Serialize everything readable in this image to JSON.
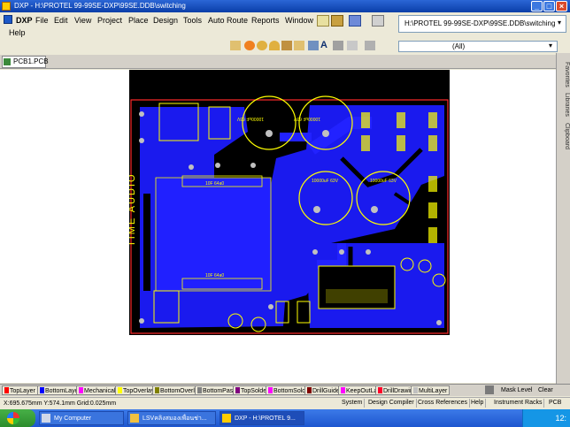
{
  "window": {
    "title": "DXP - H:\\PROTEL 99-99SE-DXP\\99SE.DDB\\switching",
    "buttons": [
      "_",
      "□",
      "×"
    ]
  },
  "menu": {
    "items": [
      "DXP",
      "File",
      "Edit",
      "View",
      "Project",
      "Place",
      "Design",
      "Tools",
      "Auto Route",
      "Reports",
      "Window",
      "Help"
    ]
  },
  "path_box": "H:\\PROTEL 99-99SE-DXP\\99SE.DDB\\switching",
  "filter_box": "(All)",
  "document_tab": "PCB1.PCB",
  "right_panel": {
    "tabs": [
      "Favorites",
      "Libraries",
      "Clipboard"
    ]
  },
  "pcb": {
    "silk_text": "TIME AUDIO",
    "capacitor_labels": [
      "10000uF 63V",
      "10000uF 63V",
      "10000uF 63V",
      "10000uF 63V"
    ],
    "chip_labels": [
      "10F 64a0",
      "10F 64a0"
    ]
  },
  "layers": [
    {
      "name": "TopLayer",
      "color": "#ff0000"
    },
    {
      "name": "BottomLayer",
      "color": "#0000ff"
    },
    {
      "name": "Mechanical1",
      "color": "#ff00ff"
    },
    {
      "name": "TopOverlay",
      "color": "#ffff00"
    },
    {
      "name": "BottomOverlay",
      "color": "#808000"
    },
    {
      "name": "BottomPaste",
      "color": "#808080"
    },
    {
      "name": "TopSolder",
      "color": "#800080"
    },
    {
      "name": "BottomSolder",
      "color": "#ff00ff"
    },
    {
      "name": "DrillGuide",
      "color": "#800000"
    },
    {
      "name": "KeepOutLayer",
      "color": "#ff00ff"
    },
    {
      "name": "DrillDrawing",
      "color": "#ff002a"
    },
    {
      "name": "MultiLayer",
      "color": "#c0c0c0"
    }
  ],
  "layer_controls": {
    "mask": "Mask Level",
    "clear": "Clear"
  },
  "status": {
    "coords": "X:695.675mm Y:574.1mm   Grid:0.025mm",
    "buttons": [
      "System",
      "Design Compiler",
      "Cross References",
      "Help",
      "Instrument Racks",
      "PCB"
    ]
  },
  "taskbar": {
    "items": [
      "My Computer",
      "LSVคลิงสมองเพื่อนช่า...",
      "DXP - H:\\PROTEL 9..."
    ],
    "clock": "12:"
  }
}
